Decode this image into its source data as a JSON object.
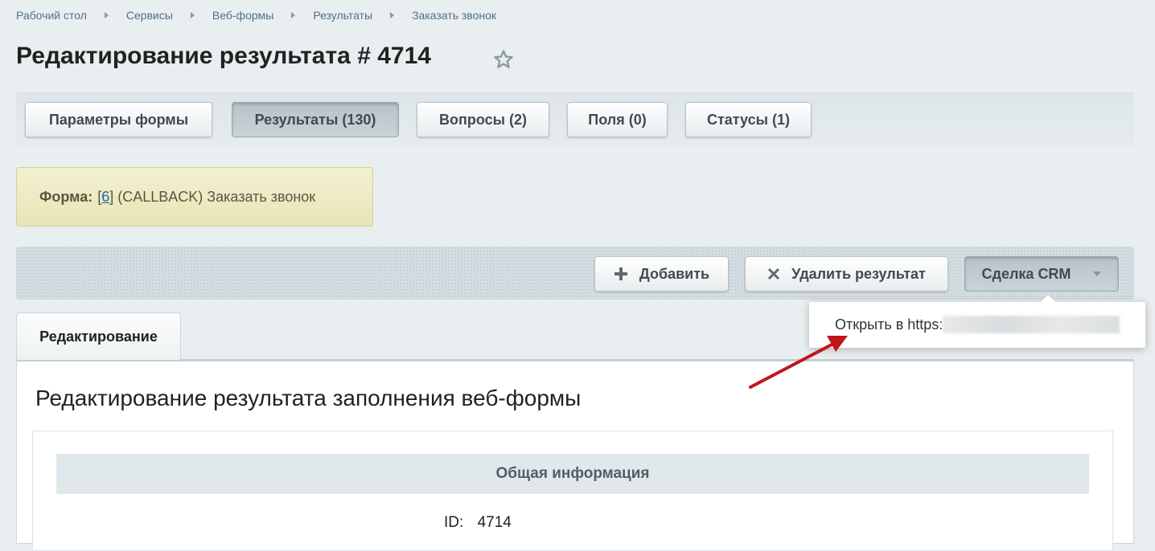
{
  "breadcrumb": [
    "Рабочий стол",
    "Сервисы",
    "Веб-формы",
    "Результаты",
    "Заказать звонок"
  ],
  "page_title": "Редактирование результата # 4714",
  "tabs": [
    {
      "label": "Параметры формы",
      "active": false
    },
    {
      "label": "Результаты (130)",
      "active": true
    },
    {
      "label": "Вопросы (2)",
      "active": false
    },
    {
      "label": "Поля (0)",
      "active": false
    },
    {
      "label": "Статусы (1)",
      "active": false
    }
  ],
  "form_info": {
    "label": "Форма:",
    "bracket_open": "[",
    "id_link": "6",
    "rest": "] (CALLBACK) Заказать звонок"
  },
  "actions": {
    "add": "Добавить",
    "delete": "Удалить результат",
    "crm": "Сделка CRM"
  },
  "dropdown": {
    "item": "Открыть в https:"
  },
  "edit_tab": "Редактирование",
  "section_title": "Редактирование результата заполнения веб-формы",
  "group_header": "Общая информация",
  "id_field": {
    "label": "ID:",
    "value": "4714"
  },
  "colors": {
    "accent_arrow": "#c0151b",
    "link": "#2067b0",
    "breadcrumb": "#516f8c"
  }
}
